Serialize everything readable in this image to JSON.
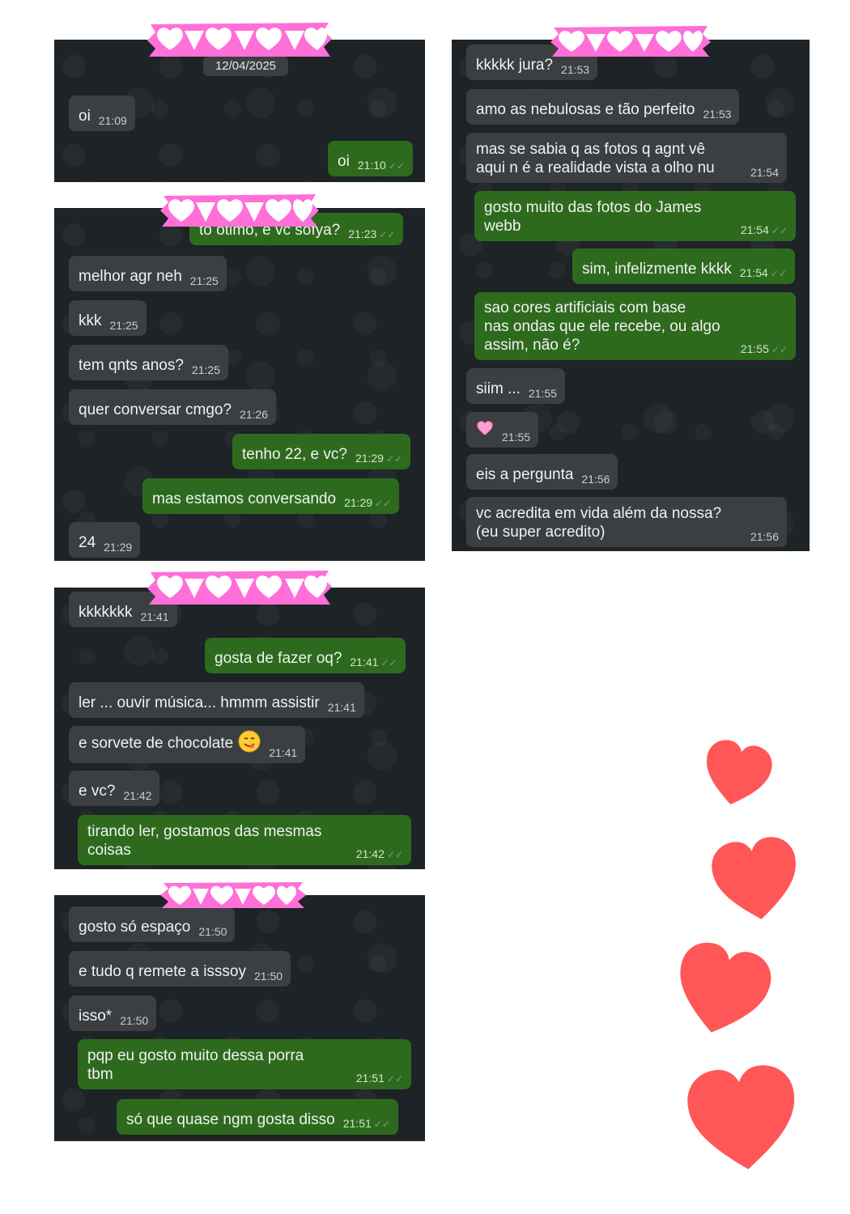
{
  "date_chip": "12/04/2025",
  "panel1": [
    {
      "dir": "in",
      "text": "oi",
      "time": "21:09"
    },
    {
      "dir": "out",
      "text": "oi",
      "time": "21:10"
    }
  ],
  "panel2": [
    {
      "dir": "out",
      "text": "to otimo, e vc sofya?",
      "time": "21:23"
    },
    {
      "dir": "in",
      "text": "melhor agr neh",
      "time": "21:25"
    },
    {
      "dir": "in",
      "text": "kkk",
      "time": "21:25"
    },
    {
      "dir": "in",
      "text": "tem qnts anos?",
      "time": "21:25"
    },
    {
      "dir": "in",
      "text": "quer conversar cmgo?",
      "time": "21:26"
    },
    {
      "dir": "out",
      "text": "tenho 22, e vc?",
      "time": "21:29"
    },
    {
      "dir": "out",
      "text": "mas estamos conversando",
      "time": "21:29"
    },
    {
      "dir": "in",
      "text": "24",
      "time": "21:29"
    }
  ],
  "panel3": [
    {
      "dir": "in",
      "text": "kkkkkkk",
      "time": "21:41"
    },
    {
      "dir": "out",
      "text": "gosta de fazer oq?",
      "time": "21:41"
    },
    {
      "dir": "in",
      "text": "ler ... ouvir música... hmmm assistir",
      "time": "21:41"
    },
    {
      "dir": "in",
      "text": "e sorvete de chocolate",
      "time": "21:41",
      "emoji": "yum-face-emoji"
    },
    {
      "dir": "in",
      "text": "e vc?",
      "time": "21:42"
    },
    {
      "dir": "out",
      "text": "tirando ler, gostamos das mesmas\ncoisas",
      "time": "21:42"
    }
  ],
  "panel4": [
    {
      "dir": "in",
      "text": "gosto só espaço",
      "time": "21:50"
    },
    {
      "dir": "in",
      "text": "e tudo q remete a isssoy",
      "time": "21:50"
    },
    {
      "dir": "in",
      "text": "isso*",
      "time": "21:50"
    },
    {
      "dir": "out",
      "text": "pqp eu gosto muito dessa porra\ntbm",
      "time": "21:51"
    },
    {
      "dir": "out",
      "text": "só que quase ngm gosta disso",
      "time": "21:51"
    }
  ],
  "panel5": [
    {
      "dir": "in",
      "text": "kkkkk jura?",
      "time": "21:53"
    },
    {
      "dir": "in",
      "text": "amo as nebulosas e tão perfeito",
      "time": "21:53"
    },
    {
      "dir": "in",
      "text": "mas se sabia q as fotos q agnt vê\naqui n é a realidade vista a olho nu",
      "time": "21:54"
    },
    {
      "dir": "out",
      "text": "gosto muito das fotos do James\nwebb",
      "time": "21:54"
    },
    {
      "dir": "out",
      "text": "sim, infelizmente kkkk",
      "time": "21:54"
    },
    {
      "dir": "out",
      "text": "sao cores artificiais com base\nnas ondas que ele recebe, ou algo\nassim, não é?",
      "time": "21:55"
    },
    {
      "dir": "in",
      "text": "siim ...",
      "time": "21:55"
    },
    {
      "dir": "in",
      "text": "",
      "time": "21:55",
      "emoji": "pink-heart-emoji"
    },
    {
      "dir": "in",
      "text": "eis a pergunta",
      "time": "21:56"
    },
    {
      "dir": "in",
      "text": "vc acredita em vida além da nossa?\n(eu super acredito)",
      "time": "21:56"
    }
  ],
  "colors": {
    "incoming": "#3b3f42",
    "outgoing": "#2e6a1e",
    "panel": "#1d2326",
    "tape": "#ff6fd8",
    "heart": "#ff5757"
  },
  "decorations": [
    "tape-hearts",
    "big-hearts"
  ]
}
